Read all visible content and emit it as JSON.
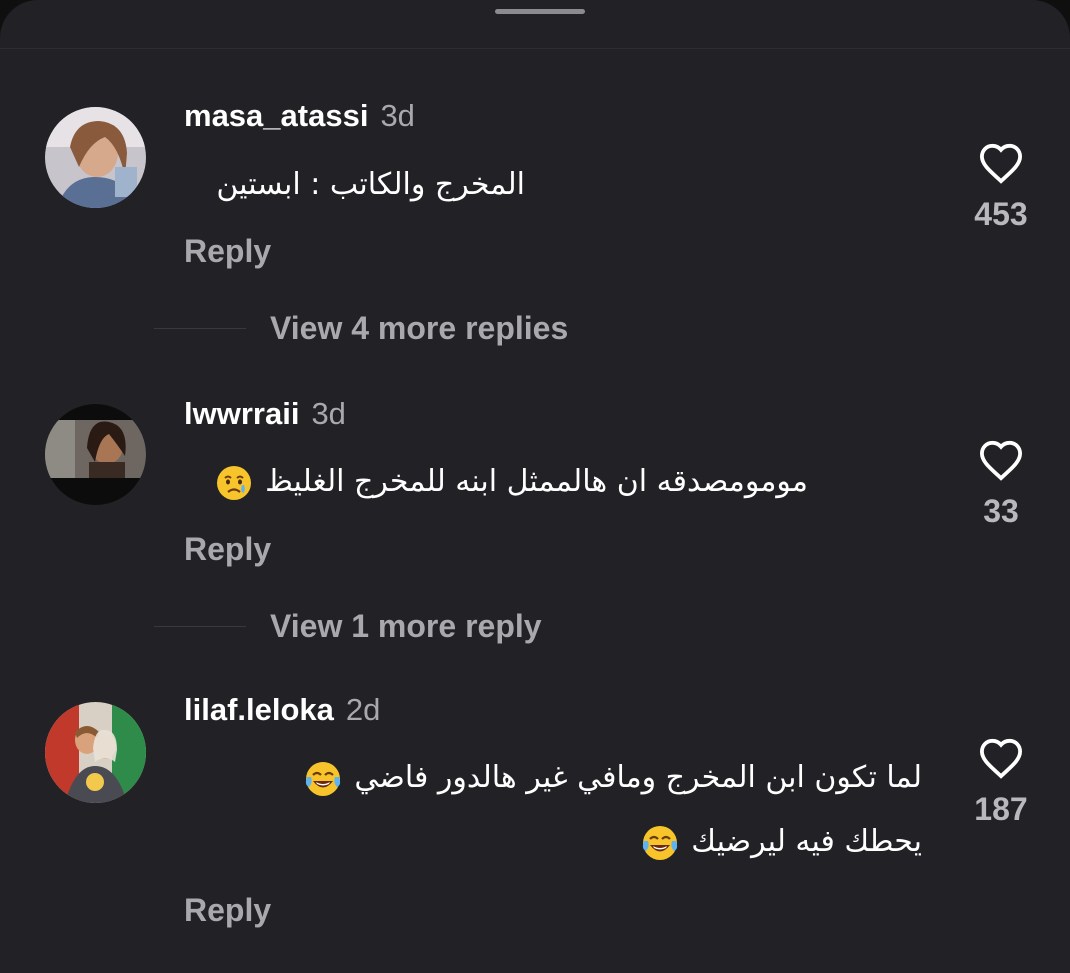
{
  "comments": [
    {
      "username": "masa_atassi",
      "time": "3d",
      "text": "المخرج والكاتب : ابستين",
      "reply_label": "Reply",
      "likes": "453",
      "view_more": "View 4 more replies"
    },
    {
      "username": "lwwrraii",
      "time": "3d",
      "text": "مومومصدقه ان هالممثل ابنه للمخرج الغليظ",
      "reply_label": "Reply",
      "likes": "33",
      "view_more": "View 1 more reply"
    },
    {
      "username": "lilaf.leloka",
      "time": "2d",
      "text_line1": "لما تكون ابن المخرج ومافي غير هالدور فاضي",
      "text_line2": "يحطك فيه ليرضيك",
      "reply_label": "Reply",
      "likes": "187"
    }
  ],
  "icons": [
    "heart-outline-icon",
    "crying-face-emoji",
    "tears-of-joy-emoji"
  ],
  "colors": {
    "background": "#222226",
    "username": "#ffffff",
    "secondary_text": "#a8a8ad",
    "emoji_yellow": "#f7c52b"
  }
}
